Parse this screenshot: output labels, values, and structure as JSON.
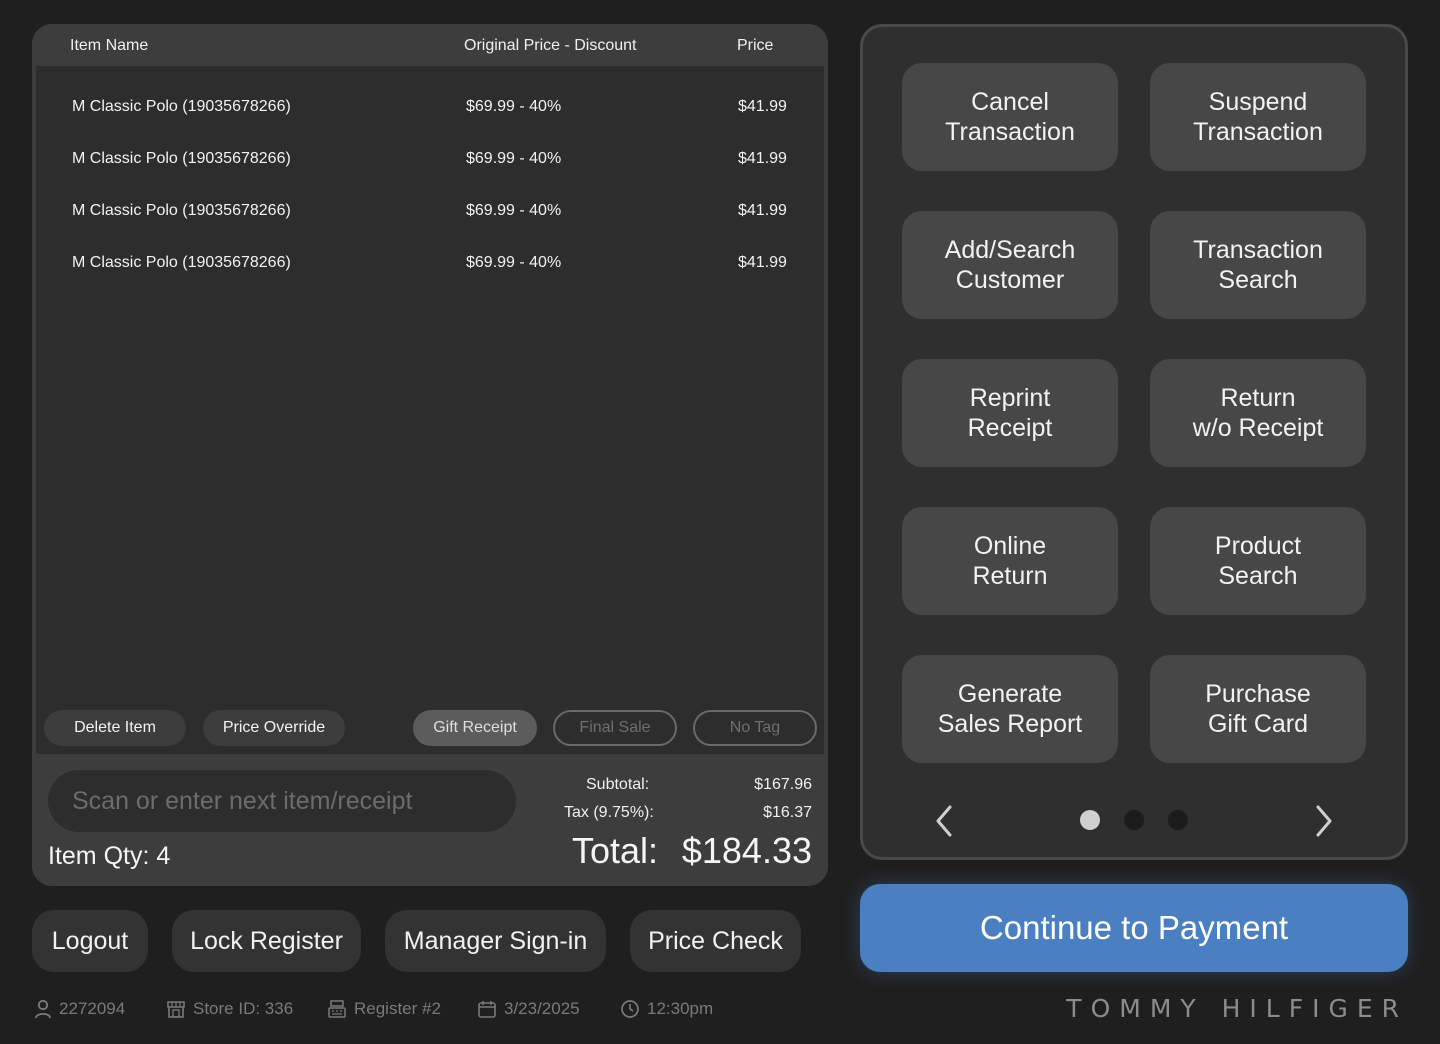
{
  "table": {
    "headers": {
      "name": "Item Name",
      "original": "Original Price - Discount",
      "price": "Price"
    },
    "rows": [
      {
        "name": "M Classic Polo (19035678266)",
        "original": "$69.99 - 40%",
        "price": "$41.99"
      },
      {
        "name": "M Classic Polo (19035678266)",
        "original": "$69.99 - 40%",
        "price": "$41.99"
      },
      {
        "name": "M Classic Polo (19035678266)",
        "original": "$69.99 - 40%",
        "price": "$41.99"
      },
      {
        "name": "M Classic Polo (19035678266)",
        "original": "$69.99 - 40%",
        "price": "$41.99"
      }
    ]
  },
  "item_actions": {
    "delete": "Delete Item",
    "override": "Price Override",
    "gift": "Gift Receipt",
    "final_sale": "Final Sale",
    "no_tag": "No Tag"
  },
  "scan": {
    "placeholder": "Scan or enter next item/receipt"
  },
  "qty": "Item Qty: 4",
  "summary": {
    "subtotal_label": "Subtotal:",
    "subtotal": "$167.96",
    "tax_label": "Tax (9.75%):",
    "tax": "$16.37",
    "total_label": "Total:",
    "total": "$184.33"
  },
  "bottom_buttons": {
    "logout": "Logout",
    "lock": "Lock Register",
    "manager": "Manager Sign-in",
    "price_check": "Price Check"
  },
  "status": {
    "user": "2272094",
    "store": "Store ID: 336",
    "register": "Register #2",
    "date": "3/23/2025",
    "time": "12:30pm"
  },
  "actions": [
    "Cancel\nTransaction",
    "Suspend\nTransaction",
    "Add/Search\nCustomer",
    "Transaction\nSearch",
    "Reprint\nReceipt",
    "Return\nw/o Receipt",
    "Online\nReturn",
    "Product\nSearch",
    "Generate\nSales Report",
    "Purchase\nGift Card"
  ],
  "pagination": {
    "pages": 3,
    "active": 1
  },
  "pay_button": "Continue to Payment",
  "brand": "TOMMY HILFIGER",
  "colors": {
    "accent": "#4a7fc1",
    "panel": "#3d3d3d",
    "background": "#1f1f1f"
  }
}
